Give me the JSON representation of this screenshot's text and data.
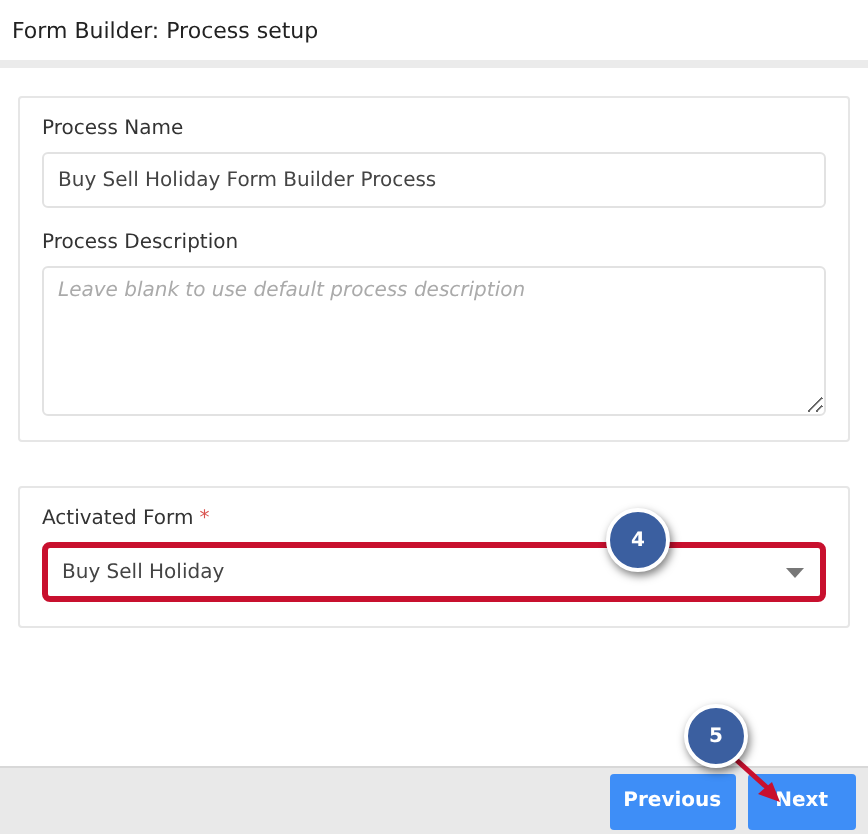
{
  "header": {
    "title": "Form Builder: Process setup"
  },
  "process_card": {
    "name_label": "Process Name",
    "name_value": "Buy Sell Holiday Form Builder Process",
    "description_label": "Process Description",
    "description_placeholder": "Leave blank to use default process description"
  },
  "form_card": {
    "label": "Activated Form",
    "required_mark": "*",
    "selected_value": "Buy Sell Holiday",
    "highlighted": true
  },
  "callouts": [
    {
      "label": "4",
      "kind": "badge"
    },
    {
      "label": "5",
      "kind": "arrow"
    }
  ],
  "footer": {
    "buttons": [
      "Previous",
      "Next"
    ]
  }
}
